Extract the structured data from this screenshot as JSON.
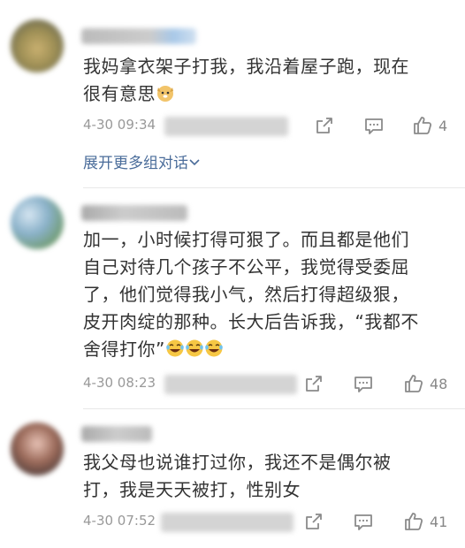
{
  "comments": [
    {
      "text_lines": [
        "我妈拿衣架子打我，我沿着屋子跑，现在",
        "很有意思"
      ],
      "emoji": "dog-face-emoji",
      "time": "4-30 09:34",
      "likes": "4"
    },
    {
      "text_lines": [
        "加一，小时候打得可狠了。而且都是他们",
        "自己对待几个孩子不公平，我觉得受委屈",
        "了，他们觉得我小气，然后打得超级狠，",
        "皮开肉绽的那种。长大后告诉我，“我都不",
        "舍得打你”"
      ],
      "emoji": "laughing-tears-emoji",
      "time": "4-30 08:23",
      "likes": "48"
    },
    {
      "text_lines": [
        "我父母也说谁打过你，我还不是偶尔被",
        "打，我是天天被打，性别女"
      ],
      "time": "4-30 07:52",
      "likes": "41"
    }
  ],
  "expand_label": "展开更多组对话",
  "colors": {
    "link": "#4a6c9a",
    "meta": "#999999",
    "icon": "#8a8a8a"
  }
}
